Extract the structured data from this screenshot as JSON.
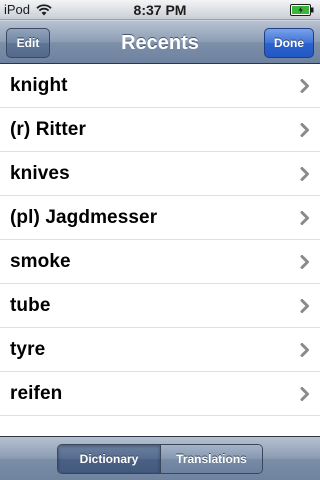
{
  "status_bar": {
    "carrier": "iPod",
    "time": "8:37 PM"
  },
  "nav_bar": {
    "title": "Recents",
    "left_button": "Edit",
    "right_button": "Done"
  },
  "list": {
    "items": [
      {
        "label": "knight"
      },
      {
        "label": "(r) Ritter"
      },
      {
        "label": "knives"
      },
      {
        "label": "(pl) Jagdmesser"
      },
      {
        "label": "smoke"
      },
      {
        "label": "tube"
      },
      {
        "label": "tyre"
      },
      {
        "label": "reifen"
      }
    ]
  },
  "toolbar": {
    "segments": [
      {
        "label": "Dictionary",
        "selected": true
      },
      {
        "label": "Translations",
        "selected": false
      }
    ]
  },
  "icons": {
    "wifi": "wifi-icon",
    "battery": "battery-icon",
    "chevron": "chevron-right-icon"
  },
  "colors": {
    "nav_bar": "#8c9db4",
    "done_button": "#2b63cf",
    "battery_fill": "#3ab63a",
    "chevron": "#8a8a8a"
  }
}
